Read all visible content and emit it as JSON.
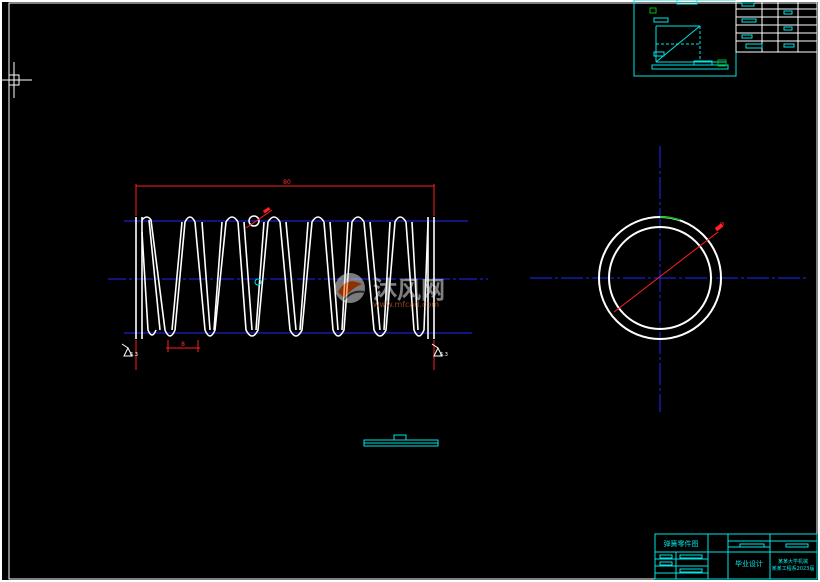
{
  "drawing": {
    "dimension_overall": "80",
    "dimension_pitch": "8",
    "dimension_diameter": "Ø",
    "surface_finish_left": "6.3",
    "surface_finish_right": "6.3"
  },
  "title_block": {
    "drawing_name": "弹簧零件图",
    "sheet_label": "毕业设计",
    "school_line1": "某某大学机械",
    "school_line2": "某某工程系2023届"
  },
  "watermark": {
    "brand": "沐风网",
    "url": "www.mfcad.com"
  },
  "colors": {
    "background": "#000000",
    "frame": "#ffffff",
    "cyan": "#00e5e5",
    "blue": "#1a2bff",
    "red": "#ff2020",
    "green": "#00c000"
  }
}
